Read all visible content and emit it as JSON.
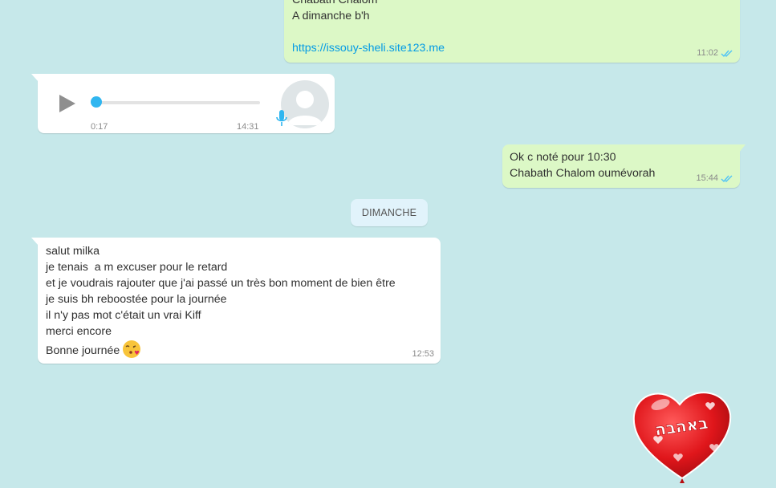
{
  "messages": {
    "m1": {
      "lines": [
        "Chabath Chalom",
        "A dimanche b'h",
        ""
      ],
      "link": "https://issouy-sheli.site123.me",
      "time": "11:02"
    },
    "voice": {
      "duration": "0:17",
      "time": "14:31",
      "progress": 0
    },
    "m3": {
      "lines": [
        "Ok c noté pour 10:30",
        "Chabath Chalom oumévorah"
      ],
      "time": "15:44"
    },
    "date_chip": "DIMANCHE",
    "m4": {
      "lines": [
        "salut milka",
        "je tenais  a m excuser pour le retard",
        "et je voudrais rajouter que j'ai passé un très bon moment de bien être",
        "je suis bh reboostée pour la journée",
        "il n'y pas mot c'était un vrai Kiff",
        "merci encore",
        "Bonne journée"
      ],
      "emoji": "face-blowing-kiss-icon",
      "time": "12:53"
    },
    "sticker": {
      "icon": "heart-balloon-sticker",
      "text": "באהבה"
    }
  },
  "colors": {
    "background": "#c6e8ea",
    "outgoing": "#dcf8c6",
    "incoming": "#ffffff",
    "link": "#039be5",
    "read_ticks": "#4fc3f7",
    "voice_accent": "#30b6f0",
    "date_chip": "#e1f3fb"
  }
}
